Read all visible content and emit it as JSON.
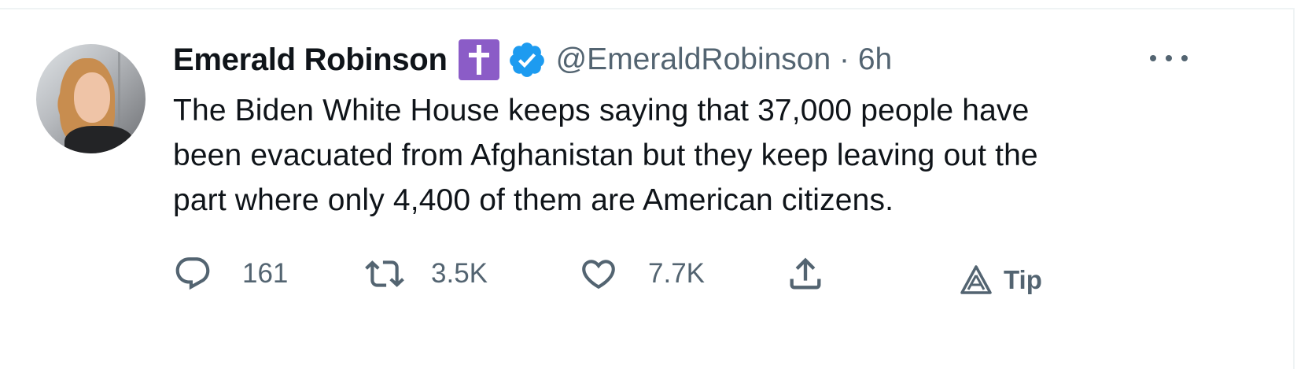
{
  "author": {
    "name": "Emerald Robinson",
    "handle_time": "@EmeraldRobinson · 6h",
    "badge": {
      "icon": "cross-icon",
      "color": "#8b5cc7"
    },
    "verified_color": "#1d9bf0"
  },
  "tweet": {
    "lines": [
      "The Biden White House keeps saying that 37,000 people have",
      "been evacuated from Afghanistan but they keep leaving out the",
      "part where only 4,400 of them are American citizens."
    ]
  },
  "actions": {
    "reply_count": "161",
    "retweet_count": "3.5K",
    "like_count": "7.7K",
    "tip_label": "Tip"
  }
}
